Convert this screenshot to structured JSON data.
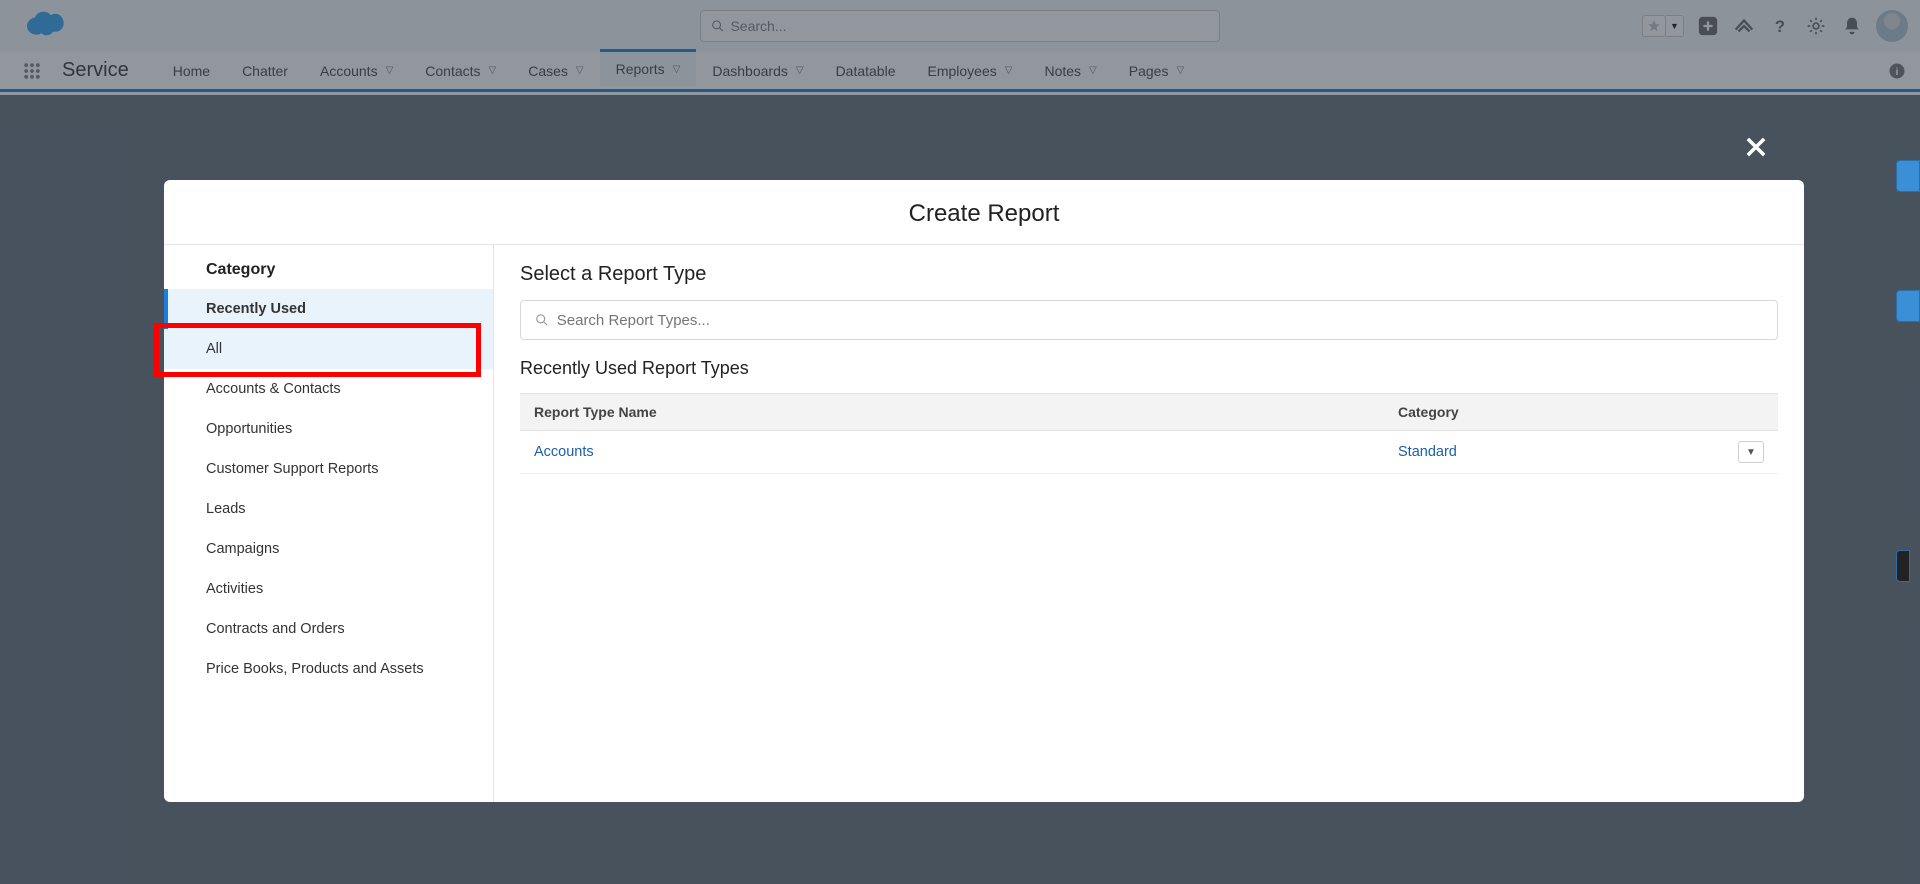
{
  "header": {
    "search_placeholder": "Search..."
  },
  "nav": {
    "app_name": "Service",
    "items": [
      {
        "label": "Home",
        "dd": false
      },
      {
        "label": "Chatter",
        "dd": false
      },
      {
        "label": "Accounts",
        "dd": true
      },
      {
        "label": "Contacts",
        "dd": true
      },
      {
        "label": "Cases",
        "dd": true
      },
      {
        "label": "Reports",
        "dd": true,
        "active": true
      },
      {
        "label": "Dashboards",
        "dd": true
      },
      {
        "label": "Datatable",
        "dd": false
      },
      {
        "label": "Employees",
        "dd": true
      },
      {
        "label": "Notes",
        "dd": true
      },
      {
        "label": "Pages",
        "dd": true
      }
    ]
  },
  "modal": {
    "title": "Create Report",
    "sidebar": {
      "heading": "Category",
      "items": [
        {
          "label": "Recently Used",
          "selected": true
        },
        {
          "label": "All",
          "highlighted": true
        },
        {
          "label": "Accounts & Contacts"
        },
        {
          "label": "Opportunities"
        },
        {
          "label": "Customer Support Reports"
        },
        {
          "label": "Leads"
        },
        {
          "label": "Campaigns"
        },
        {
          "label": "Activities"
        },
        {
          "label": "Contracts and Orders"
        },
        {
          "label": "Price Books, Products and Assets"
        }
      ]
    },
    "main": {
      "heading": "Select a Report Type",
      "search_placeholder": "Search Report Types...",
      "subheading": "Recently Used Report Types",
      "columns": {
        "name": "Report Type Name",
        "category": "Category"
      },
      "rows": [
        {
          "name": "Accounts",
          "category": "Standard"
        }
      ]
    }
  }
}
